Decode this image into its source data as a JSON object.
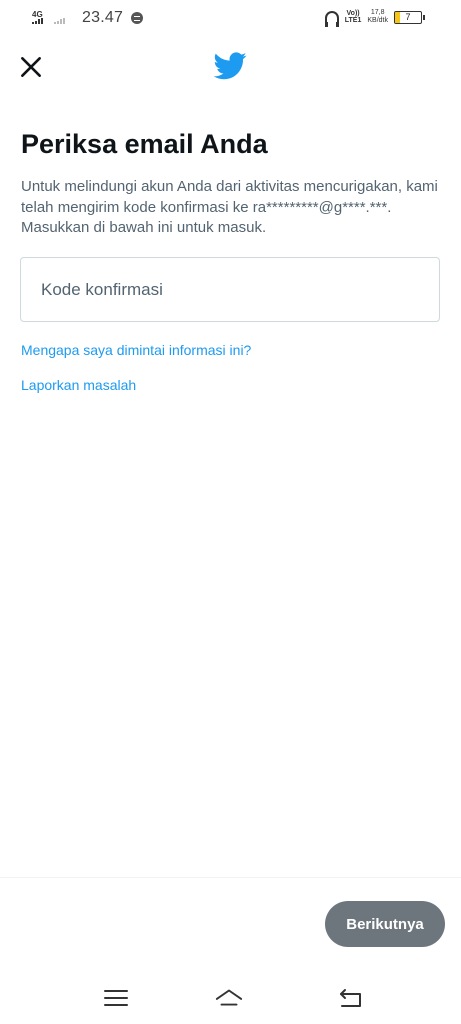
{
  "status_bar": {
    "network": "4G",
    "time": "23.47",
    "volte_top": "Vo))",
    "volte_bottom": "LTE1",
    "speed_value": "17,8",
    "speed_unit": "KB/dtk",
    "battery": "7",
    "battery_level": 0.2
  },
  "header": {
    "close_icon": "close-icon",
    "logo_icon": "twitter-bird-icon",
    "logo_color": "#1d9bf0"
  },
  "main": {
    "title": "Periksa email Anda",
    "description": "Untuk melindungi akun Anda dari aktivitas mencurigakan, kami telah mengirim kode konfirmasi ke ra*********@g****.***. Masukkan di bawah ini untuk masuk.",
    "code_input": {
      "placeholder": "Kode konfirmasi",
      "value": ""
    },
    "why_link": "Mengapa saya dimintai informasi ini?",
    "report_link": "Laporkan masalah"
  },
  "footer": {
    "next_label": "Berikutnya",
    "next_color": "#6e767d"
  },
  "nav_bar": {
    "menu_icon": "menu-icon",
    "home_icon": "home-icon",
    "back_icon": "back-icon"
  },
  "colors": {
    "accent": "#1d9bf0",
    "text_primary": "#0f1419",
    "text_secondary": "#536471"
  }
}
